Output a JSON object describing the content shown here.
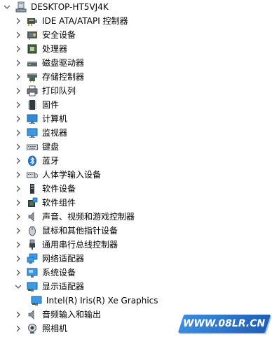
{
  "window": {
    "root_label": "DESKTOP-HT5VJ4K"
  },
  "tree": {
    "items": [
      {
        "label": "IDE ATA/ATAPI 控制器",
        "icon": "ide-controller-icon",
        "expanded": false
      },
      {
        "label": "安全设备",
        "icon": "security-device-icon",
        "expanded": false
      },
      {
        "label": "处理器",
        "icon": "processor-icon",
        "expanded": false
      },
      {
        "label": "磁盘驱动器",
        "icon": "disk-drive-icon",
        "expanded": false
      },
      {
        "label": "存储控制器",
        "icon": "storage-controller-icon",
        "expanded": false
      },
      {
        "label": "打印队列",
        "icon": "printer-icon",
        "expanded": false
      },
      {
        "label": "固件",
        "icon": "firmware-icon",
        "expanded": false
      },
      {
        "label": "计算机",
        "icon": "computer-icon",
        "expanded": false
      },
      {
        "label": "监视器",
        "icon": "monitor-icon",
        "expanded": false
      },
      {
        "label": "键盘",
        "icon": "keyboard-icon",
        "expanded": false
      },
      {
        "label": "蓝牙",
        "icon": "bluetooth-icon",
        "expanded": false
      },
      {
        "label": "人体学输入设备",
        "icon": "hid-icon",
        "expanded": false
      },
      {
        "label": "软件设备",
        "icon": "software-device-icon",
        "expanded": false
      },
      {
        "label": "软件组件",
        "icon": "software-component-icon",
        "expanded": false
      },
      {
        "label": "声音、视频和游戏控制器",
        "icon": "speaker-icon",
        "expanded": false
      },
      {
        "label": "鼠标和其他指针设备",
        "icon": "mouse-icon",
        "expanded": false
      },
      {
        "label": "通用串行总线控制器",
        "icon": "usb-icon",
        "expanded": false
      },
      {
        "label": "网络适配器",
        "icon": "network-adapter-icon",
        "expanded": false
      },
      {
        "label": "系统设备",
        "icon": "system-device-icon",
        "expanded": false
      },
      {
        "label": "显示适配器",
        "icon": "display-adapter-icon",
        "expanded": true,
        "children": [
          {
            "label": "Intel(R) Iris(R) Xe Graphics",
            "icon": "display-adapter-icon"
          }
        ]
      },
      {
        "label": "音频输入和输出",
        "icon": "audio-io-icon",
        "expanded": false
      },
      {
        "label": "照相机",
        "icon": "camera-icon",
        "expanded": false
      }
    ]
  },
  "watermark": {
    "text": "WWW.08LR.CN"
  },
  "colors": {
    "chevron": "#5a5a5a",
    "watermark_bg": "#2a72cc",
    "monitor_blue": "#2e8bd8"
  }
}
